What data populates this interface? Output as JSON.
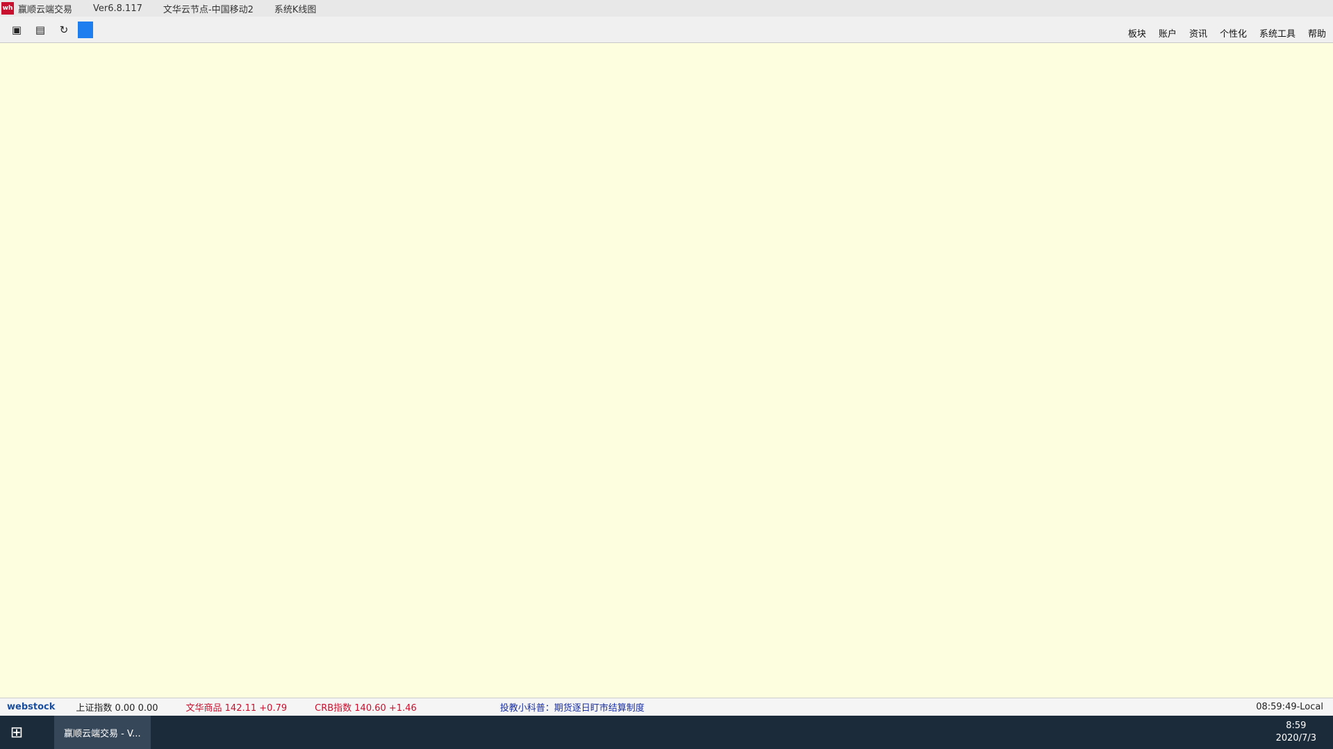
{
  "window": {
    "app_name": "赢顺云端交易",
    "version": "Ver6.8.117",
    "node": "文华云节点-中国移动2",
    "view": "系统K线图"
  },
  "menus": [
    "板块",
    "账户",
    "资讯",
    "个性化",
    "系统工具",
    "帮助"
  ],
  "status": {
    "brand": "webstock",
    "index1": "上证指数  0.00  0.00",
    "index2": "文华商品  142.11  +0.79",
    "index3": "CRB指数  140.60  +1.46",
    "notice": "投教小科普：期货逐日盯市结算制度",
    "clock": "08:59:49-Local"
  },
  "taskbar": {
    "task_label": "赢顺云端交易 - V...",
    "time": "8:59",
    "date": "2020/7/3"
  }
}
